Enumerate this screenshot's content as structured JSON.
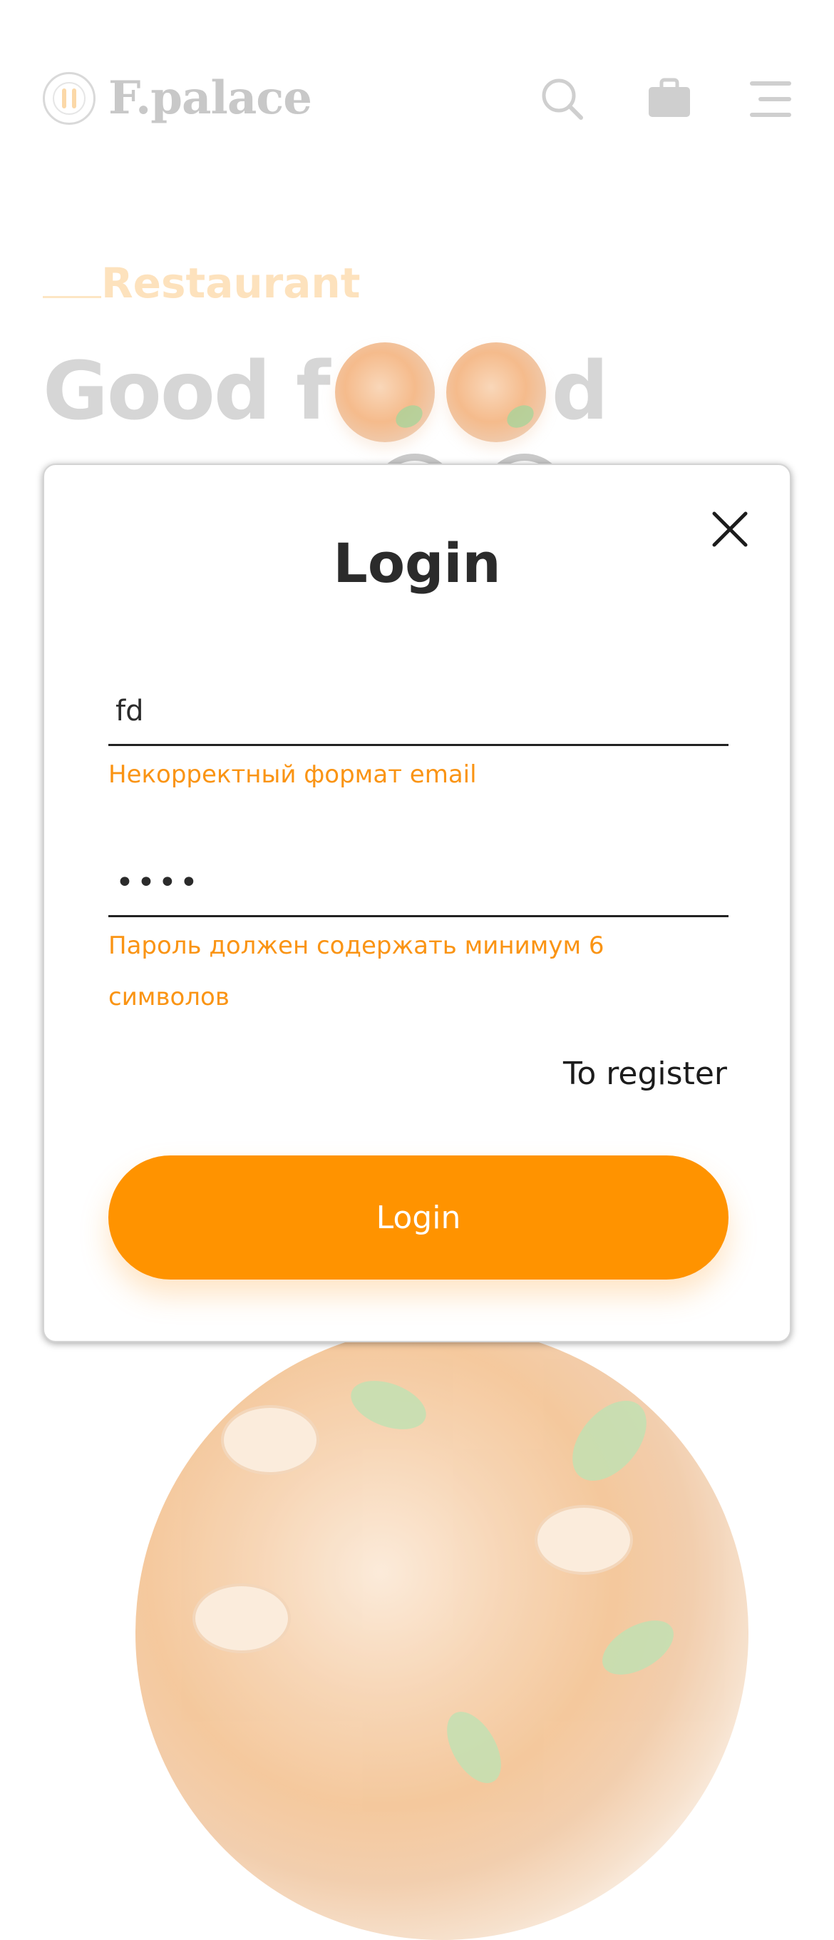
{
  "header": {
    "logo_text": "F.palace",
    "search_icon": "search-icon",
    "bag_icon": "bag-icon",
    "menu_icon": "hamburger-menu-icon"
  },
  "hero": {
    "eyebrow": "Restaurant",
    "title_part1": "Good f",
    "title_part2": "d"
  },
  "modal": {
    "title": "Login",
    "email": {
      "value": "fd",
      "error": "Некорректный формат email"
    },
    "password": {
      "value": "1234",
      "error": "Пароль должен содержать минимум 6 символов"
    },
    "register_link": "To register",
    "submit_label": "Login"
  },
  "colors": {
    "accent": "#ff9300",
    "error": "#fa9414",
    "text": "#2b2b2b"
  }
}
